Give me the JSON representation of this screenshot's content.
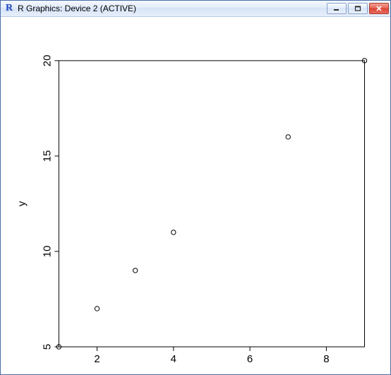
{
  "window": {
    "title": "R Graphics: Device 2 (ACTIVE)",
    "icon_letter": "R"
  },
  "chart_data": {
    "type": "scatter",
    "x": [
      1,
      2,
      3,
      4,
      7,
      9
    ],
    "y": [
      5,
      7,
      9,
      11,
      16,
      20
    ],
    "xlabel": "",
    "ylabel": "y",
    "xlim": [
      1,
      9
    ],
    "ylim": [
      5,
      20
    ],
    "x_ticks": [
      2,
      4,
      6,
      8
    ],
    "y_ticks": [
      5,
      10,
      15,
      20
    ],
    "grid": false
  }
}
